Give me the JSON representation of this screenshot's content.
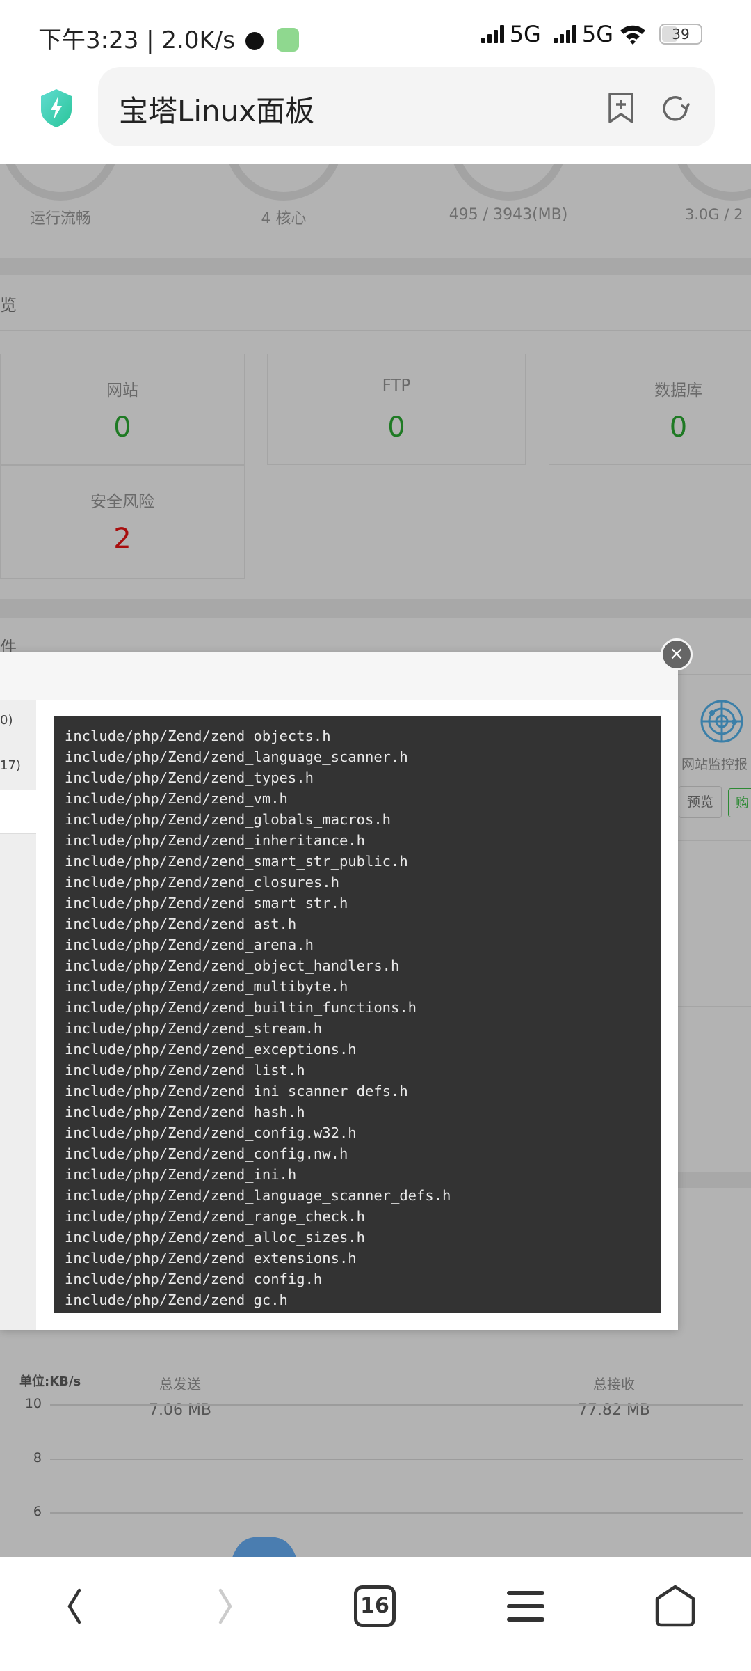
{
  "status_bar": {
    "time_speed": "下午3:23 | 2.0K/s",
    "network1": "5G",
    "network2": "5G",
    "battery": "39"
  },
  "browser": {
    "page_title": "宝塔Linux面板"
  },
  "gauges": [
    {
      "label": "运行流畅"
    },
    {
      "label": "4 核心"
    },
    {
      "label": "495 / 3943(MB)"
    },
    {
      "label": "3.0G / 2"
    }
  ],
  "overview": {
    "title": "览",
    "cards": [
      {
        "label": "网站",
        "value": "0"
      },
      {
        "label": "FTP",
        "value": "0"
      },
      {
        "label": "数据库",
        "value": "0"
      },
      {
        "label": "安全风险",
        "value": "2"
      }
    ]
  },
  "software": {
    "title": "件",
    "plugin_name": "网站监控报",
    "preview_button": "预览",
    "buy_button": "购"
  },
  "modal": {
    "left_items": [
      "0)",
      "17)"
    ],
    "close_label": "×",
    "log_lines": [
      "include/php/Zend/zend_objects.h",
      "include/php/Zend/zend_language_scanner.h",
      "include/php/Zend/zend_types.h",
      "include/php/Zend/zend_vm.h",
      "include/php/Zend/zend_globals_macros.h",
      "include/php/Zend/zend_inheritance.h",
      "include/php/Zend/zend_smart_str_public.h",
      "include/php/Zend/zend_closures.h",
      "include/php/Zend/zend_smart_str.h",
      "include/php/Zend/zend_ast.h",
      "include/php/Zend/zend_arena.h",
      "include/php/Zend/zend_object_handlers.h",
      "include/php/Zend/zend_multibyte.h",
      "include/php/Zend/zend_builtin_functions.h",
      "include/php/Zend/zend_stream.h",
      "include/php/Zend/zend_exceptions.h",
      "include/php/Zend/zend_list.h",
      "include/php/Zend/zend_ini_scanner_defs.h",
      "include/php/Zend/zend_hash.h",
      "include/php/Zend/zend_config.w32.h",
      "include/php/Zend/zend_config.nw.h",
      "include/php/Zend/zend_ini.h",
      "include/php/Zend/zend_language_scanner_defs.h",
      "include/php/Zend/zend_range_check.h",
      "include/php/Zend/zend_alloc_sizes.h",
      "include/php/Zend/zend_extensions.h",
      "include/php/Zend/zend_config.h",
      "include/php/Zend/zend_gc.h"
    ]
  },
  "traffic": {
    "unit": "单位:KB/s",
    "sent_label": "总发送",
    "sent_value": "7.06 MB",
    "recv_label": "总接收",
    "recv_value": "77.82 MB"
  },
  "chart_data": {
    "type": "area",
    "ylabel": "单位:KB/s",
    "y_ticks": [
      "10",
      "8",
      "6"
    ],
    "series_color": "#4a7db0"
  },
  "bottom_nav": {
    "tab_count": "16"
  },
  "colors": {
    "accent_green": "#20a53a",
    "danger_red": "#cc0000",
    "terminal_bg": "#333333"
  }
}
